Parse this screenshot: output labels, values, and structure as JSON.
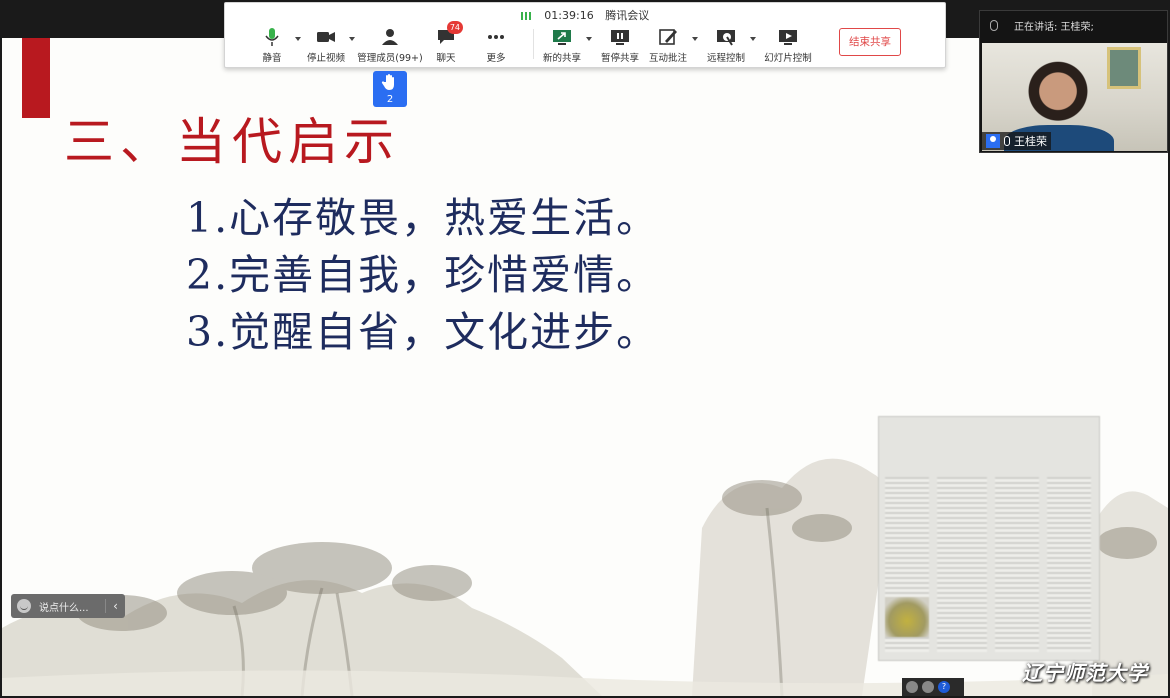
{
  "toolbar": {
    "status": {
      "time": "01:39:16",
      "app_name": "腾讯会议"
    },
    "buttons": {
      "mute": "静音",
      "stop_video": "停止视频",
      "manage_members": "管理成员(99+)",
      "chat": "聊天",
      "chat_badge": "74",
      "more": "更多",
      "new_share": "新的共享",
      "pause_share": "暂停共享",
      "annotate": "互动批注",
      "remote_control": "远程控制",
      "slide_control": "幻灯片控制",
      "end_share": "结束共享"
    }
  },
  "raise_hand": {
    "count": "2"
  },
  "speaker_panel": {
    "status": "正在讲话: 王桂荣;",
    "name": "王桂荣"
  },
  "slide": {
    "title": "三、当代启示",
    "items": [
      "1.心存敬畏，热爱生活。",
      "2.完善自我，珍惜爱情。",
      "3.觉醒自省，文化进步。"
    ],
    "watermark": "辽宁师范大学"
  },
  "chat_input": {
    "placeholder": "说点什么..."
  },
  "colors": {
    "title_red": "#b8191f",
    "list_navy": "#1e2c5e",
    "end_share_red": "#e04848",
    "hand_blue": "#2b6ef2"
  }
}
